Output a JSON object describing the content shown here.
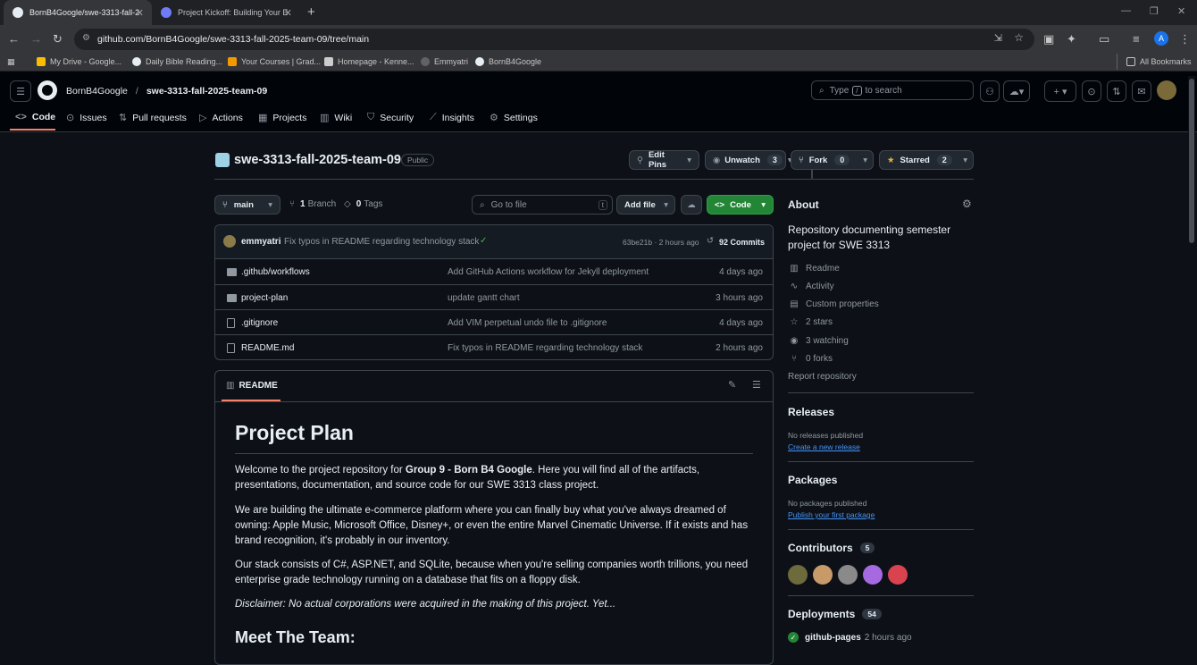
{
  "browser": {
    "tabs": [
      {
        "title": "BornB4Google/swe-3313-fall-2",
        "active": true
      },
      {
        "title": "Project Kickoff: Building Your E",
        "active": false
      }
    ],
    "url": "github.com/BornB4Google/swe-3313-fall-2025-team-09/tree/main",
    "bookmarks": [
      "My Drive - Google...",
      "Daily Bible Reading...",
      "Your Courses | Grad...",
      "Homepage - Kenne...",
      "Emmyatri",
      "BornB4Google"
    ],
    "all_bookmarks": "All Bookmarks",
    "profile_initial": "A"
  },
  "github": {
    "owner": "BornB4Google",
    "repo": "swe-3313-fall-2025-team-09",
    "search_placeholder_pre": "Type",
    "search_key": "/",
    "search_placeholder_post": "to search",
    "nav": [
      "Code",
      "Issues",
      "Pull requests",
      "Actions",
      "Projects",
      "Wiki",
      "Security",
      "Insights",
      "Settings"
    ]
  },
  "repo_header": {
    "name": "swe-3313-fall-2025-team-09",
    "visibility": "Public",
    "edit_pins": "Edit Pins",
    "unwatch": "Unwatch",
    "watch_count": "3",
    "fork": "Fork",
    "fork_count": "0",
    "starred": "Starred",
    "star_count": "2"
  },
  "toolbar": {
    "branch": "main",
    "branches_count": "1",
    "branches_label": "Branch",
    "tags_count": "0",
    "tags_label": "Tags",
    "goto_placeholder": "Go to file",
    "goto_key": "t",
    "add_file": "Add file",
    "code": "Code"
  },
  "latest_commit": {
    "author": "emmyatri",
    "message": "Fix typos in README regarding technology stack",
    "hash_time": "63be21b · 2 hours ago",
    "commits": "92 Commits"
  },
  "files": [
    {
      "name": ".github/workflows",
      "type": "folder",
      "message": "Add GitHub Actions workflow for Jekyll deployment",
      "age": "4 days ago"
    },
    {
      "name": "project-plan",
      "type": "folder",
      "message": "update gantt chart",
      "age": "3 hours ago"
    },
    {
      "name": ".gitignore",
      "type": "file",
      "message": "Add VIM perpetual undo file to .gitignore",
      "age": "4 days ago"
    },
    {
      "name": "README.md",
      "type": "file",
      "message": "Fix typos in README regarding technology stack",
      "age": "2 hours ago"
    }
  ],
  "readme": {
    "tab": "README",
    "title": "Project Plan",
    "p1_pre": "Welcome to the project repository for ",
    "p1_bold": "Group 9 - Born B4 Google",
    "p1_post": ". Here you will find all of the artifacts, presentations, documentation, and source code for our SWE 3313 class project.",
    "p2": "We are building the ultimate e-commerce platform where you can finally buy what you've always dreamed of owning: Apple Music, Microsoft Office, Disney+, or even the entire Marvel Cinematic Universe. If it exists and has brand recognition, it's probably in our inventory.",
    "p3": "Our stack consists of C#, ASP.NET, and SQLite, because when you're selling companies worth trillions, you need enterprise grade technology running on a database that fits on a floppy disk.",
    "p4": "Disclaimer: No actual corporations were acquired in the making of this project. Yet...",
    "h2": "Meet The Team:"
  },
  "about": {
    "heading": "About",
    "description": "Repository documenting semester project for SWE 3313",
    "items": [
      {
        "icon": "book-icon",
        "label": "Readme"
      },
      {
        "icon": "pulse-icon",
        "label": "Activity"
      },
      {
        "icon": "note-icon",
        "label": "Custom properties"
      },
      {
        "icon": "star-icon",
        "label": "2 stars"
      },
      {
        "icon": "eye-icon",
        "label": "3 watching"
      },
      {
        "icon": "fork-icon",
        "label": "0 forks"
      }
    ],
    "report": "Report repository"
  },
  "releases": {
    "heading": "Releases",
    "none": "No releases published",
    "link": "Create a new release"
  },
  "packages": {
    "heading": "Packages",
    "none": "No packages published",
    "link": "Publish your first package"
  },
  "contributors": {
    "heading": "Contributors",
    "count": "5"
  },
  "deployments": {
    "heading": "Deployments",
    "count": "54",
    "env": "github-pages",
    "time": "2 hours ago"
  },
  "colors": {
    "accent": "#238636",
    "link": "#4493f8",
    "folder": "#9198a1",
    "bg": "#0d1117"
  }
}
